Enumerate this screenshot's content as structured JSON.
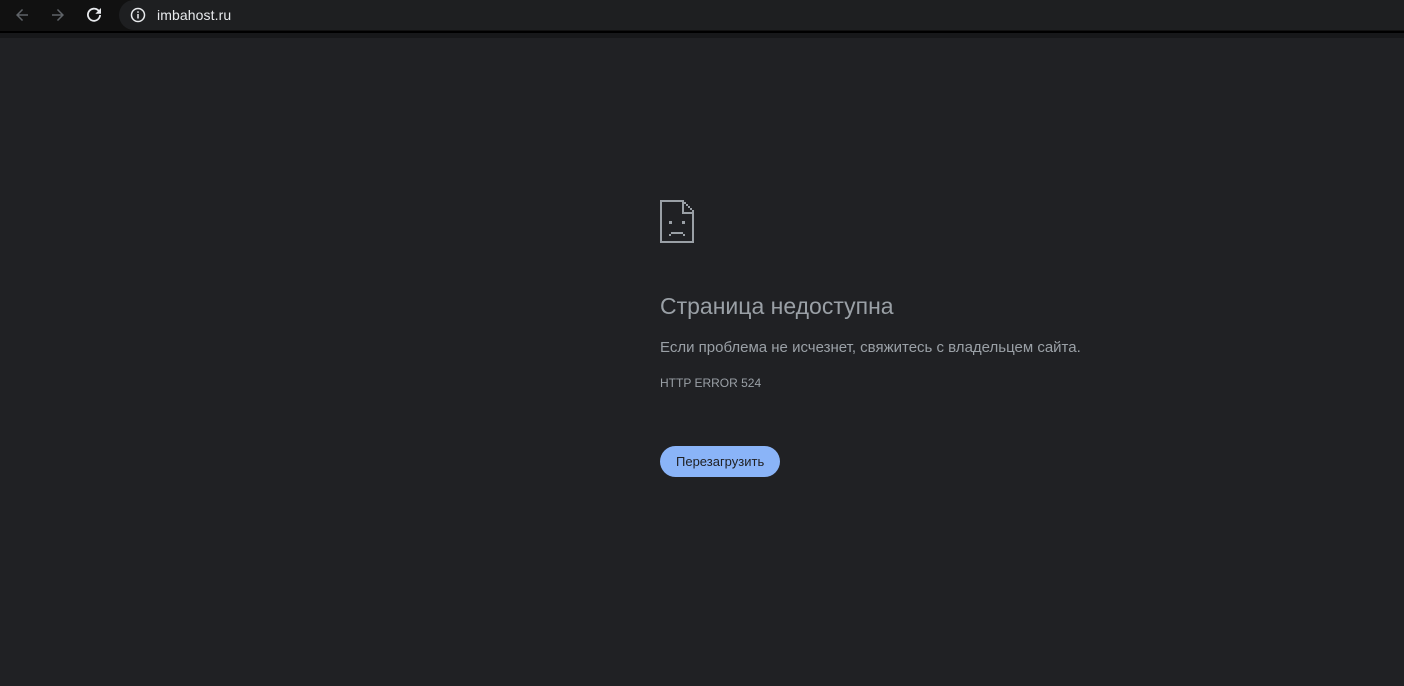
{
  "browser": {
    "back_icon": "arrow-left-icon",
    "forward_icon": "arrow-right-icon",
    "reload_icon": "reload-icon",
    "site_info_icon": "info-icon",
    "url": "imbahost.ru"
  },
  "error_page": {
    "icon": "sad-document-icon",
    "title": "Страница недоступна",
    "message": "Если проблема не исчезнет, свяжитесь с владельцем сайта.",
    "error_code": "HTTP ERROR 524",
    "reload_button_label": "Перезагрузить"
  },
  "colors": {
    "page_background": "#202124",
    "toolbar_background": "#111111",
    "text_secondary": "#9aa0a6",
    "button_background": "#8ab4f8",
    "button_text": "#202124"
  }
}
